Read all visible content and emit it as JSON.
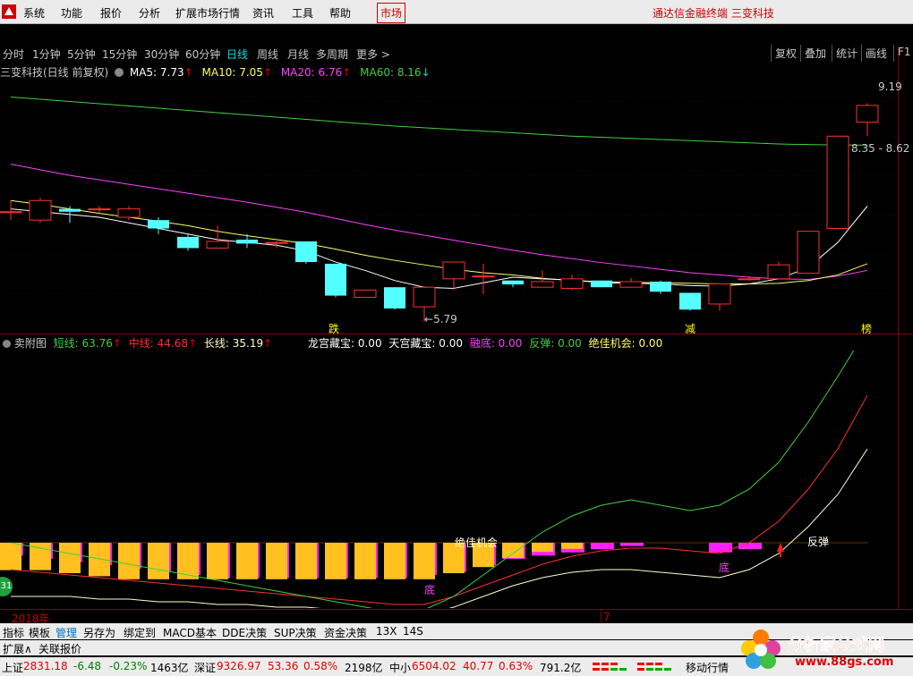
{
  "menu": {
    "items": [
      "系统",
      "功能",
      "报价",
      "分析",
      "扩展市场行情",
      "资讯",
      "工具",
      "帮助"
    ],
    "market": "市场",
    "brand": "通达信金融终端  三变科技"
  },
  "periods": {
    "items": [
      "分时",
      "1分钟",
      "5分钟",
      "15分钟",
      "30分钟",
      "60分钟",
      "日线",
      "周线",
      "月线",
      "多周期",
      "更多 >"
    ],
    "active": "日线",
    "right_buttons": [
      "复权",
      "叠加",
      "统计",
      "画线",
      "F1"
    ]
  },
  "main_legend": {
    "stock_title": "三变科技(日线 前复权)",
    "ma5": {
      "label": "MA5: 7.73",
      "arrow": "↑",
      "color": "#ffffff"
    },
    "ma10": {
      "label": "MA10: 7.05",
      "arrow": "↑",
      "color": "#ffff66"
    },
    "ma20": {
      "label": "MA20: 6.76",
      "arrow": "↑",
      "color": "#ff40ff"
    },
    "ma60": {
      "label": "MA60: 8.16",
      "arrow": "↓",
      "color": "#40d040"
    }
  },
  "price_annotations": {
    "high": "9.19",
    "range": "8.35 - 8.62",
    "low": "5.79",
    "markers": [
      "跌",
      "减",
      "榜"
    ]
  },
  "sub_legend": {
    "title": "卖附图",
    "short": "短线: 63.76",
    "mid": "中线: 44.68",
    "long": "长线: 35.19",
    "arrow": "↑",
    "lg": "龙宫藏宝: 0.00",
    "tg": "天宫藏宝: 0.00",
    "rd": "融底: 0.00",
    "ft": "反弹: 0.00",
    "jj": "绝佳机会: 0.00"
  },
  "sub_annotations": {
    "jjjh": "绝佳机会",
    "fantan": "反弹",
    "di1": "底",
    "di2": "底",
    "left_badge": "31"
  },
  "axis": {
    "year": "2018年",
    "month": "7"
  },
  "chart_data": {
    "type": "candlestick",
    "candles": [
      {
        "o": 7.25,
        "h": 7.45,
        "l": 7.1,
        "c": 7.25
      },
      {
        "o": 7.1,
        "h": 7.5,
        "l": 7.05,
        "c": 7.45
      },
      {
        "o": 7.3,
        "h": 7.35,
        "l": 7.05,
        "c": 7.25
      },
      {
        "o": 7.3,
        "h": 7.35,
        "l": 7.2,
        "c": 7.3
      },
      {
        "o": 7.15,
        "h": 7.35,
        "l": 7.1,
        "c": 7.3
      },
      {
        "o": 7.1,
        "h": 7.15,
        "l": 6.85,
        "c": 6.95
      },
      {
        "o": 6.8,
        "h": 6.85,
        "l": 6.55,
        "c": 6.6
      },
      {
        "o": 6.6,
        "h": 7.0,
        "l": 6.6,
        "c": 6.72
      },
      {
        "o": 6.75,
        "h": 6.85,
        "l": 6.6,
        "c": 6.68
      },
      {
        "o": 6.7,
        "h": 6.72,
        "l": 6.6,
        "c": 6.7
      },
      {
        "o": 6.72,
        "h": 6.72,
        "l": 6.32,
        "c": 6.35
      },
      {
        "o": 6.32,
        "h": 6.32,
        "l": 5.72,
        "c": 5.75
      },
      {
        "o": 5.72,
        "h": 5.85,
        "l": 5.72,
        "c": 5.85
      },
      {
        "o": 5.9,
        "h": 5.9,
        "l": 5.5,
        "c": 5.52
      },
      {
        "o": 5.55,
        "h": 5.92,
        "l": 5.28,
        "c": 5.9
      },
      {
        "o": 6.05,
        "h": 6.32,
        "l": 5.85,
        "c": 6.35
      },
      {
        "o": 6.1,
        "h": 6.32,
        "l": 5.78,
        "c": 6.1
      },
      {
        "o": 6.02,
        "h": 6.02,
        "l": 5.9,
        "c": 5.95
      },
      {
        "o": 5.9,
        "h": 6.2,
        "l": 5.9,
        "c": 6.0
      },
      {
        "o": 5.88,
        "h": 6.12,
        "l": 5.85,
        "c": 6.05
      },
      {
        "o": 6.02,
        "h": 6.02,
        "l": 5.9,
        "c": 5.9
      },
      {
        "o": 5.9,
        "h": 6.07,
        "l": 5.9,
        "c": 6.0
      },
      {
        "o": 6.0,
        "h": 6.02,
        "l": 5.78,
        "c": 5.82
      },
      {
        "o": 5.8,
        "h": 5.8,
        "l": 5.48,
        "c": 5.5
      },
      {
        "o": 5.6,
        "h": 5.97,
        "l": 5.48,
        "c": 5.96
      },
      {
        "o": 6.05,
        "h": 6.1,
        "l": 6.02,
        "c": 6.05
      },
      {
        "o": 6.05,
        "h": 6.35,
        "l": 6.05,
        "c": 6.3
      },
      {
        "o": 6.15,
        "h": 6.9,
        "l": 6.15,
        "c": 6.9
      },
      {
        "o": 6.95,
        "h": 8.6,
        "l": 6.95,
        "c": 8.6
      },
      {
        "o": 8.85,
        "h": 9.19,
        "l": 8.6,
        "c": 9.15
      }
    ],
    "ylim": [
      5.2,
      9.5
    ],
    "ma5": [
      7.3,
      7.25,
      7.2,
      7.15,
      7.05,
      6.95,
      6.85,
      6.75,
      6.7,
      6.65,
      6.55,
      6.35,
      6.2,
      6.02,
      5.9,
      5.88,
      5.98,
      6.08,
      6.05,
      6.03,
      5.98,
      5.97,
      5.96,
      5.93,
      5.92,
      5.96,
      6.05,
      6.25,
      6.7,
      7.35
    ],
    "ma10": [
      7.45,
      7.38,
      7.3,
      7.22,
      7.15,
      7.08,
      7.0,
      6.9,
      6.82,
      6.75,
      6.68,
      6.58,
      6.47,
      6.38,
      6.3,
      6.22,
      6.16,
      6.12,
      6.06,
      6.02,
      6.0,
      5.99,
      5.98,
      5.97,
      5.96,
      5.96,
      5.97,
      6.02,
      6.12,
      6.32
    ],
    "ma20": [
      8.1,
      8.0,
      7.9,
      7.82,
      7.74,
      7.66,
      7.58,
      7.5,
      7.42,
      7.33,
      7.24,
      7.13,
      7.02,
      6.92,
      6.83,
      6.74,
      6.65,
      6.56,
      6.48,
      6.41,
      6.34,
      6.28,
      6.22,
      6.16,
      6.12,
      6.08,
      6.05,
      6.04,
      6.1,
      6.2
    ],
    "ma60": [
      9.3,
      9.26,
      9.22,
      9.18,
      9.14,
      9.1,
      9.06,
      9.02,
      8.98,
      8.94,
      8.9,
      8.86,
      8.82,
      8.78,
      8.75,
      8.72,
      8.69,
      8.66,
      8.63,
      8.6,
      8.58,
      8.56,
      8.54,
      8.52,
      8.5,
      8.48,
      8.46,
      8.45,
      8.44,
      8.44
    ],
    "sub": {
      "bars": [
        18,
        18,
        20,
        22,
        24,
        24,
        24,
        24,
        24,
        24,
        24,
        24,
        24,
        24,
        24,
        20,
        16,
        10,
        6,
        4,
        0,
        0,
        0,
        0,
        0,
        0,
        0,
        0,
        0,
        0
      ],
      "magenta": [
        8,
        10,
        12,
        14,
        16,
        18,
        20,
        22,
        22,
        22,
        22,
        22,
        22,
        22,
        20,
        18,
        14,
        10,
        8,
        6,
        4,
        2,
        0,
        0,
        6,
        4,
        0,
        0,
        0,
        0
      ],
      "short": [
        0,
        -2,
        -4,
        -6,
        -8,
        -10,
        -12,
        -14,
        -16,
        -18,
        -20,
        -22,
        -24,
        -26,
        -25,
        -20,
        -12,
        -4,
        4,
        10,
        14,
        16,
        14,
        12,
        14,
        20,
        30,
        45,
        62,
        80
      ],
      "mid": [
        -10,
        -11,
        -12,
        -13,
        -14,
        -15,
        -16,
        -17,
        -18,
        -19,
        -20,
        -21,
        -22,
        -23,
        -23,
        -20,
        -16,
        -12,
        -8,
        -5,
        -3,
        -2,
        -2,
        -3,
        -4,
        0,
        8,
        20,
        35,
        55
      ],
      "long": [
        -20,
        -20,
        -20,
        -21,
        -21,
        -22,
        -22,
        -23,
        -23,
        -24,
        -24,
        -25,
        -25,
        -26,
        -27,
        -24,
        -20,
        -16,
        -13,
        -11,
        -10,
        -10,
        -11,
        -12,
        -13,
        -10,
        -4,
        6,
        18,
        35
      ]
    }
  },
  "bottom_tabs": [
    "指标",
    "模板",
    "管理",
    "另存为",
    "绑定到",
    "MACD基本",
    "DDE决策",
    "SUP决策",
    "资金决策",
    "13X",
    "14S"
  ],
  "bottom_active": "管理",
  "ext_tabs": [
    "扩展∧",
    "关联报价"
  ],
  "status": {
    "sh_label": "上证",
    "sh_val": "2831.18",
    "sh_chg": "-6.48",
    "sh_pct": "-0.23%",
    "sh_amt": "1463亿",
    "sz_label": "深证",
    "sz_val": "9326.97",
    "sz_chg": "53.36",
    "sz_pct": "0.58%",
    "sz_amt": "2198亿",
    "zx_label": "中小",
    "zx_val": "6504.02",
    "zx_chg": "40.77",
    "zx_pct": "0.63%",
    "zx_amt": "791.2亿",
    "mobile": "移动行情"
  },
  "watermark": {
    "name": "分析家公式网",
    "url": "www.88gs.com"
  }
}
